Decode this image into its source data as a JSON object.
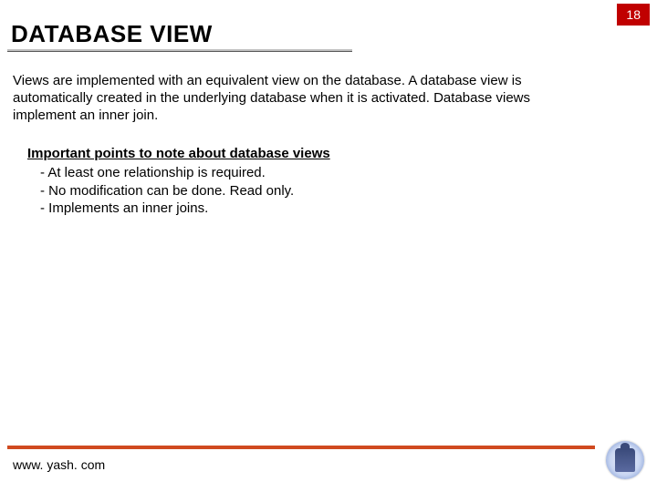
{
  "page_number": "18",
  "title": "DATABASE VIEW",
  "intro": "Views are implemented with an equivalent view on the database. A database view is automatically created in the underlying database when it is activated. Database views implement an inner join.",
  "subhead": "Important points to note about database views",
  "bullets": [
    "At least one relationship is required.",
    "No modification can be done. Read only.",
    "Implements an inner joins."
  ],
  "footer_url": "www. yash. com"
}
